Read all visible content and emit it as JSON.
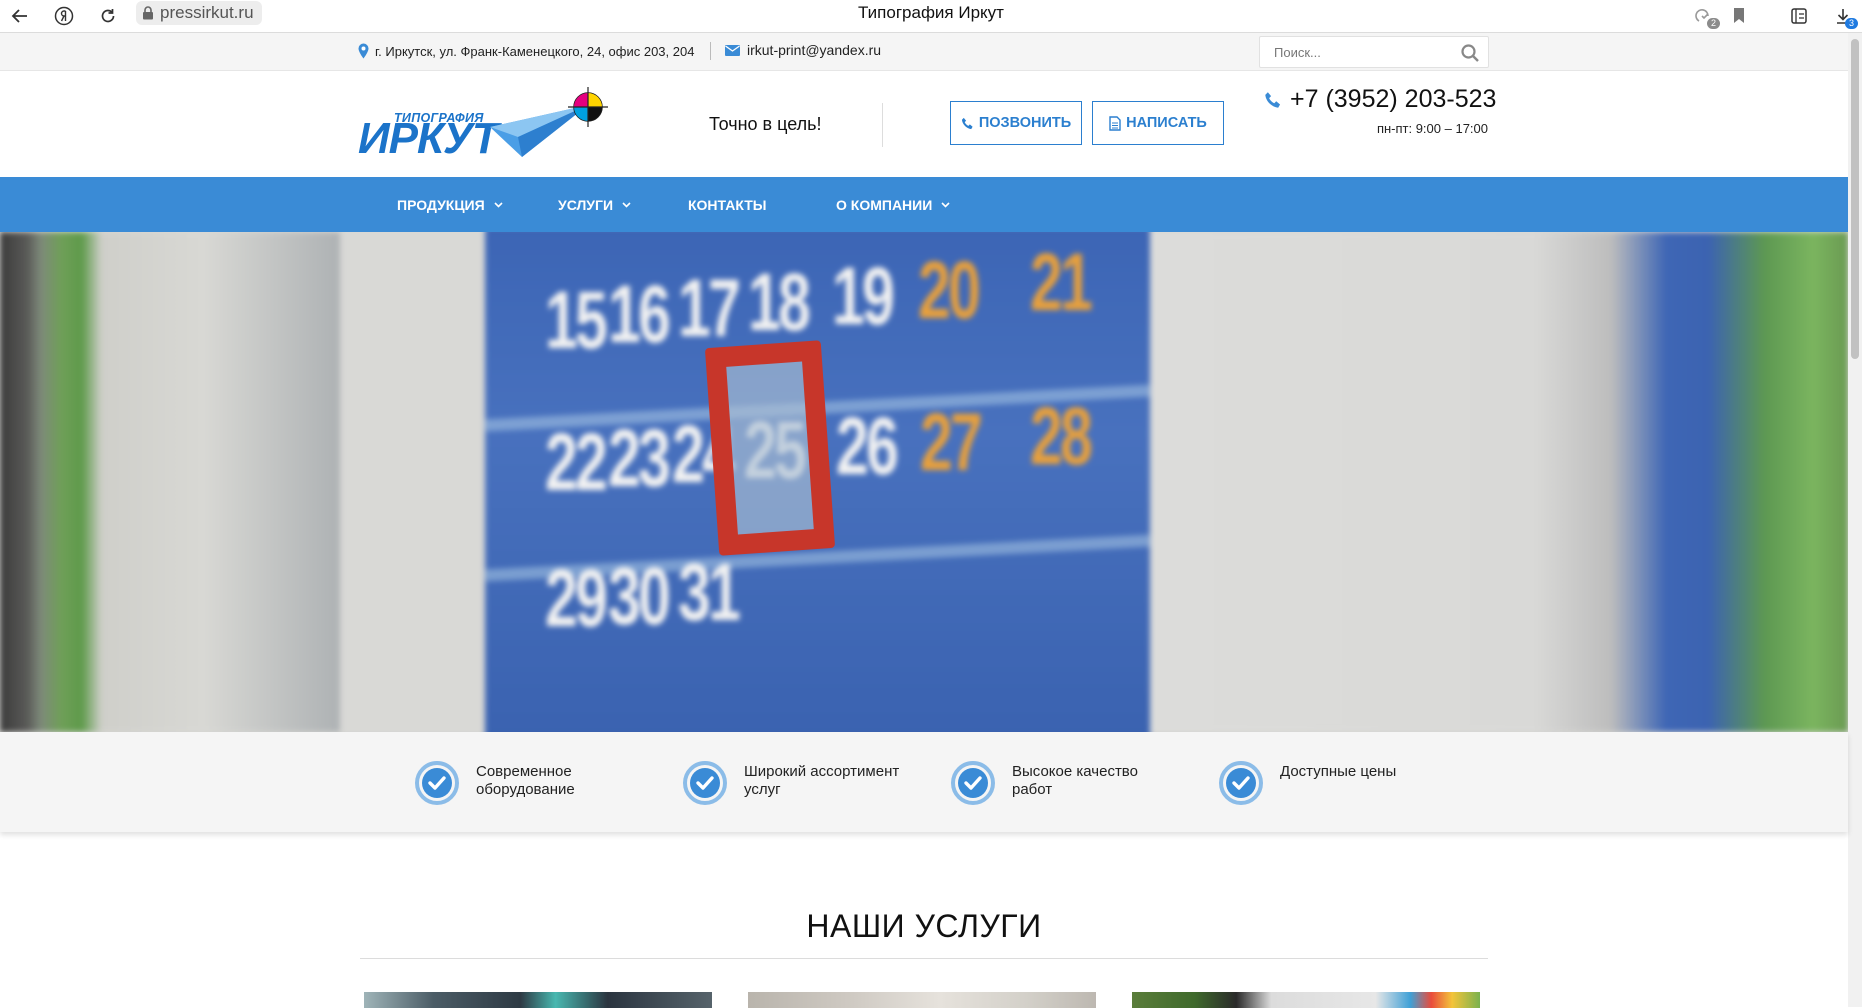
{
  "browser": {
    "url": "pressirkut.ru",
    "title": "Типография Иркут",
    "badges": {
      "protect": "2",
      "downloads": "3"
    }
  },
  "topbar": {
    "address": "г. Иркутск, ул. Франк-Каменецкого, 24, офис 203, 204",
    "email": "irkut-print@yandex.ru",
    "search_placeholder": "Поиск..."
  },
  "header": {
    "logo_small": "ТИПОГРАФИЯ",
    "logo_big": "ИРКУТ",
    "slogan": "Точно в цель!",
    "call_label": "ПОЗВОНИТЬ",
    "write_label": "НАПИСАТЬ",
    "phone": "+7 (3952) 203-523",
    "hours": "пн-пт: 9:00 – 17:00"
  },
  "nav": {
    "items": [
      {
        "label": "ПРОДУКЦИЯ"
      },
      {
        "label": "УСЛУГИ"
      },
      {
        "label": "КОНТАКТЫ"
      },
      {
        "label": "О КОМПАНИИ"
      }
    ]
  },
  "hero": {
    "row1": [
      "15",
      "16",
      "17",
      "18",
      "19",
      "20",
      "21"
    ],
    "row2": [
      "22",
      "23",
      "24",
      "25",
      "26",
      "27",
      "28"
    ],
    "row3": [
      "29",
      "30",
      "31"
    ]
  },
  "features": [
    {
      "line1": "Современное",
      "line2": "оборудование"
    },
    {
      "line1": "Широкий ассортимент",
      "line2": "услуг"
    },
    {
      "line1": "Высокое качество",
      "line2": "работ"
    },
    {
      "line1": "Доступные цены",
      "line2": ""
    }
  ],
  "services": {
    "title": "НАШИ УСЛУГИ"
  },
  "colors": {
    "brand_blue": "#3a8bd6",
    "button_border": "#2b7fcf",
    "logo_blue": "#1b73c9"
  }
}
